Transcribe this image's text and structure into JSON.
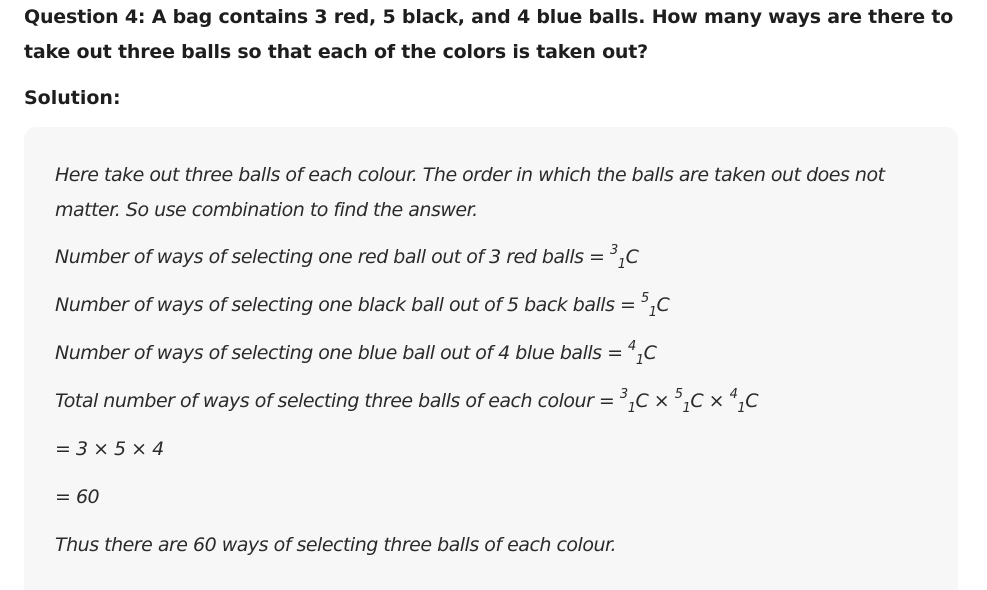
{
  "question": {
    "text": "Question 4: A bag contains 3 red, 5 black, and 4 blue balls. How many ways are there to take out three balls so that each of the colors is taken out?"
  },
  "solution_label": "Solution:",
  "solution": {
    "intro": "Here take out three balls of each colour. The order in which the balls are taken out does not matter. So use combination to find the answer.",
    "red_line": "Number of ways of selecting one red ball out of 3 red balls =",
    "red_n": "3",
    "red_r": "1",
    "black_line": "Number of ways of selecting one black ball out of 5 back balls =",
    "black_n": "5",
    "black_r": "1",
    "blue_line": "Number of ways of selecting one blue ball out of 4 blue balls =",
    "blue_n": "4",
    "blue_r": "1",
    "total_line": "Total number of ways of selecting three balls of each colour =",
    "total_terms": [
      {
        "n": "3",
        "r": "1"
      },
      {
        "n": "5",
        "r": "1"
      },
      {
        "n": "4",
        "r": "1"
      }
    ],
    "symbol_c": "C",
    "times": "×",
    "step1": "= 3 × 5 × 4",
    "step2": "= 60",
    "conclusion": "Thus there are 60 ways of selecting three balls of each colour."
  }
}
